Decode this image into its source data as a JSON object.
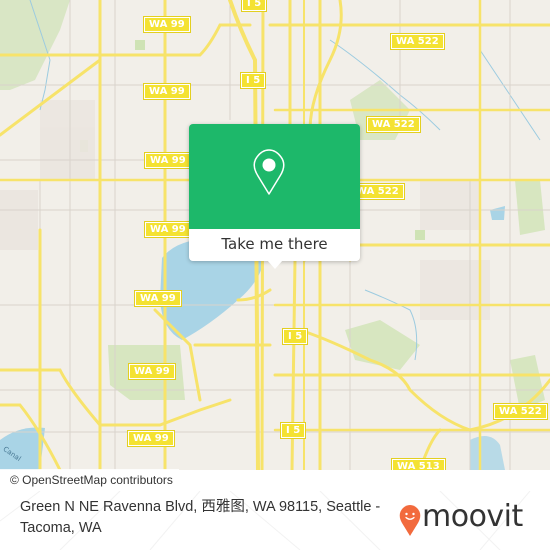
{
  "map": {
    "water_color": "#a9d4e6",
    "park_color": "#cfe3b5",
    "road_color": "#f7e36a",
    "background_color": "#f2efe9",
    "shields": [
      {
        "label": "WA 99"
      },
      {
        "label": "WA 99"
      },
      {
        "label": "WA 99"
      },
      {
        "label": "WA 99"
      },
      {
        "label": "WA 99"
      },
      {
        "label": "WA 99"
      },
      {
        "label": "WA 99"
      },
      {
        "label": "I 5"
      },
      {
        "label": "I 5"
      },
      {
        "label": "I 5"
      },
      {
        "label": "I 5"
      },
      {
        "label": "I 5"
      },
      {
        "label": "WA 522"
      },
      {
        "label": "WA 522"
      },
      {
        "label": "WA 522"
      },
      {
        "label": "WA 522"
      },
      {
        "label": "WA 513"
      },
      {
        "label": "WA 513"
      }
    ],
    "water_label": "Canal"
  },
  "popup": {
    "icon": "map-pin-icon",
    "accent_color": "#1db86a",
    "button_label": "Take me there"
  },
  "attribution": "© OpenStreetMap contributors",
  "footer": {
    "address": "Green N NE Ravenna Blvd, 西雅图, WA 98115, Seattle - Tacoma, WA",
    "brand": "moovit",
    "brand_color": "#f26a3d"
  }
}
